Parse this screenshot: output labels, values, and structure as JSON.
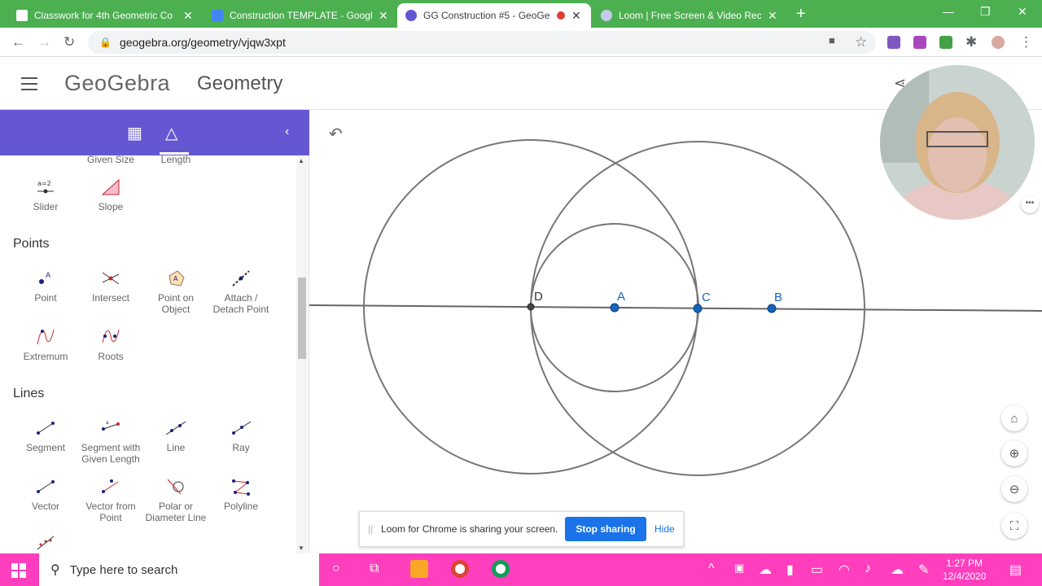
{
  "browser": {
    "tabs": [
      {
        "title": "Classwork for 4th Geometric Co",
        "color": "#0f9d58"
      },
      {
        "title": "Construction TEMPLATE - Google",
        "color": "#4285f4"
      },
      {
        "title": "GG Construction #5 - GeoGe",
        "color": "#6557d2"
      },
      {
        "title": "Loom | Free Screen & Video Rec",
        "color": "#625df5"
      }
    ],
    "url": "geogebra.org/geometry/vjqw3xpt"
  },
  "header": {
    "logo": "GeoGebra",
    "app_title": "Geometry"
  },
  "tools": {
    "top": [
      "Given Size",
      "Length",
      "Slider",
      "Slope"
    ],
    "points_heading": "Points",
    "points": [
      "Point",
      "Intersect",
      "Point on Object",
      "Attach / Detach Point",
      "Extremum",
      "Roots"
    ],
    "lines_heading": "Lines",
    "lines": [
      "Segment",
      "Segment with Given Length",
      "Line",
      "Ray",
      "Vector",
      "Vector from Point",
      "Polar or Diameter Line",
      "Polyline"
    ]
  },
  "construction": {
    "points": [
      {
        "label": "D",
        "color": "#333333"
      },
      {
        "label": "A",
        "color": "#1565c0"
      },
      {
        "label": "C",
        "color": "#1565c0"
      },
      {
        "label": "B",
        "color": "#1565c0"
      }
    ]
  },
  "loom": {
    "message": "Loom for Chrome is sharing your screen.",
    "stop": "Stop sharing",
    "hide": "Hide"
  },
  "taskbar": {
    "search_placeholder": "Type here to search",
    "time": "1:27 PM",
    "date": "12/4/2020"
  },
  "icons": [
    "menu-icon",
    "share-icon",
    "calculator-icon",
    "geometry-icon",
    "collapse-icon",
    "undo-icon",
    "home-icon",
    "zoom-in-icon",
    "zoom-out-icon",
    "fullscreen-icon",
    "windows-icon",
    "search-icon"
  ]
}
